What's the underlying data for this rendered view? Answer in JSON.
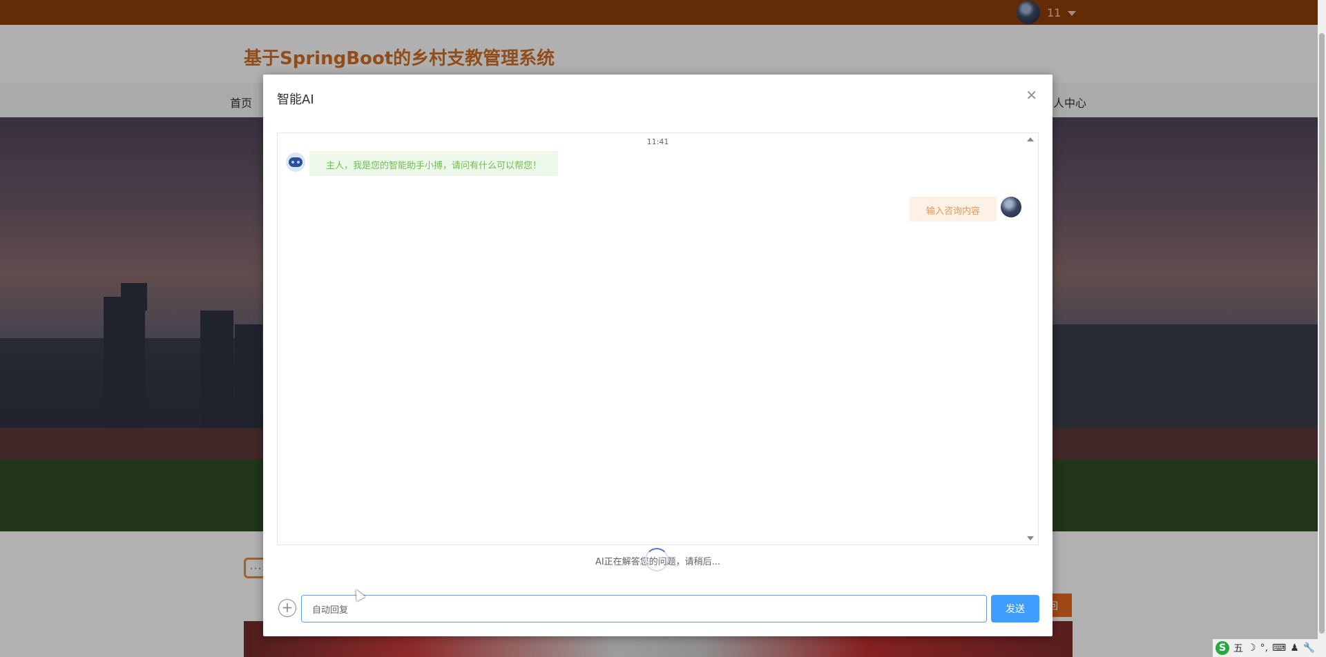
{
  "topbar": {
    "username": "11"
  },
  "header": {
    "site_title": "基于SpringBoot的乡村支教管理系统"
  },
  "nav": {
    "items": [
      "首页",
      "人中心"
    ]
  },
  "modal": {
    "title": "智能AI",
    "close_icon": "close-icon",
    "chat": {
      "time": "11:41",
      "bot_message": "主人，我是您的智能助手小搏，请问有什么可以帮您！",
      "user_message": "输入咨询内容"
    },
    "status_text": "AI正在解答您的问题，请稍后...",
    "input_value": "自动回复",
    "send_label": "发送"
  },
  "lower": {
    "more_label": "回"
  },
  "ime": {
    "logo": "S",
    "items": [
      "五",
      "☽",
      "°,",
      "⌨",
      "♟",
      "🔧"
    ]
  }
}
